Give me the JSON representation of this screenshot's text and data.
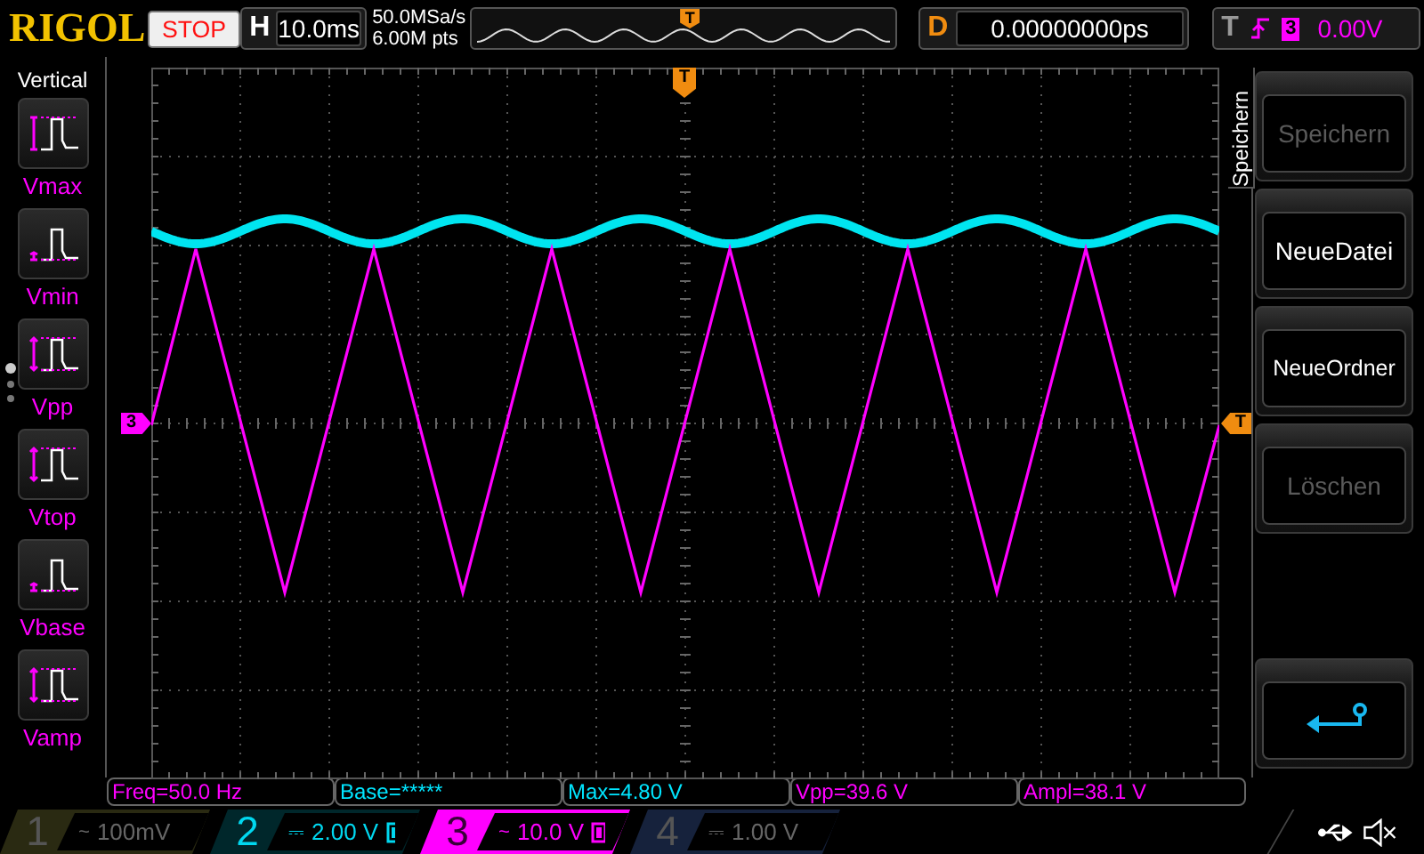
{
  "brand": "RIGOL",
  "run_state": {
    "label": "STOP",
    "kind": "stop"
  },
  "horizontal": {
    "label": "H",
    "value": "10.0ms"
  },
  "acquisition": {
    "sample_rate": "50.0MSa/s",
    "memory_depth": "6.00M pts"
  },
  "overview": {
    "trigger_marker": "T"
  },
  "delay": {
    "label": "D",
    "value": "0.00000000ps"
  },
  "trigger": {
    "label": "T",
    "source": "3",
    "level_reading": "0.00V"
  },
  "measure_panel": {
    "title": "Vertical",
    "items": [
      {
        "label": "Vmax",
        "kind": "max"
      },
      {
        "label": "Vmin",
        "kind": "min"
      },
      {
        "label": "Vpp",
        "kind": "pp"
      },
      {
        "label": "Vtop",
        "kind": "top"
      },
      {
        "label": "Vbase",
        "kind": "base"
      },
      {
        "label": "Vamp",
        "kind": "amp"
      }
    ]
  },
  "display": {
    "trigger_position_marker": "T",
    "trigger_level_marker": "T",
    "channel_marker": "3"
  },
  "menu": {
    "tab": "Speichern",
    "buttons": [
      {
        "label": "Speichern",
        "disabled": true
      },
      {
        "label": "NeueDatei",
        "disabled": false
      },
      {
        "label": "NeueOrdner",
        "disabled": false
      },
      {
        "label": "Löschen",
        "disabled": true
      }
    ]
  },
  "measurements": [
    {
      "text": "Freq=50.0 Hz",
      "color": "#ff00ff"
    },
    {
      "text": "Base=*****",
      "color": "#00e5ff"
    },
    {
      "text": "Max=4.80 V",
      "color": "#00e5ff"
    },
    {
      "text": "Vpp=39.6 V",
      "color": "#ff00ff"
    },
    {
      "text": "Ampl=38.1 V",
      "color": "#ff00ff"
    }
  ],
  "channels": [
    {
      "number": "1",
      "coupling": "~",
      "scale": "100mV",
      "color": "#2a2a12",
      "on": false,
      "selected": false
    },
    {
      "number": "2",
      "coupling": "⎓",
      "scale": "2.00 V",
      "color": "#00d8f0",
      "on": true,
      "selected": false
    },
    {
      "number": "3",
      "coupling": "~",
      "scale": "10.0 V",
      "color": "#ff00ff",
      "on": true,
      "selected": true
    },
    {
      "number": "4",
      "coupling": "⎓",
      "scale": "1.00 V",
      "color": "#16223c",
      "on": false,
      "selected": false
    }
  ]
}
